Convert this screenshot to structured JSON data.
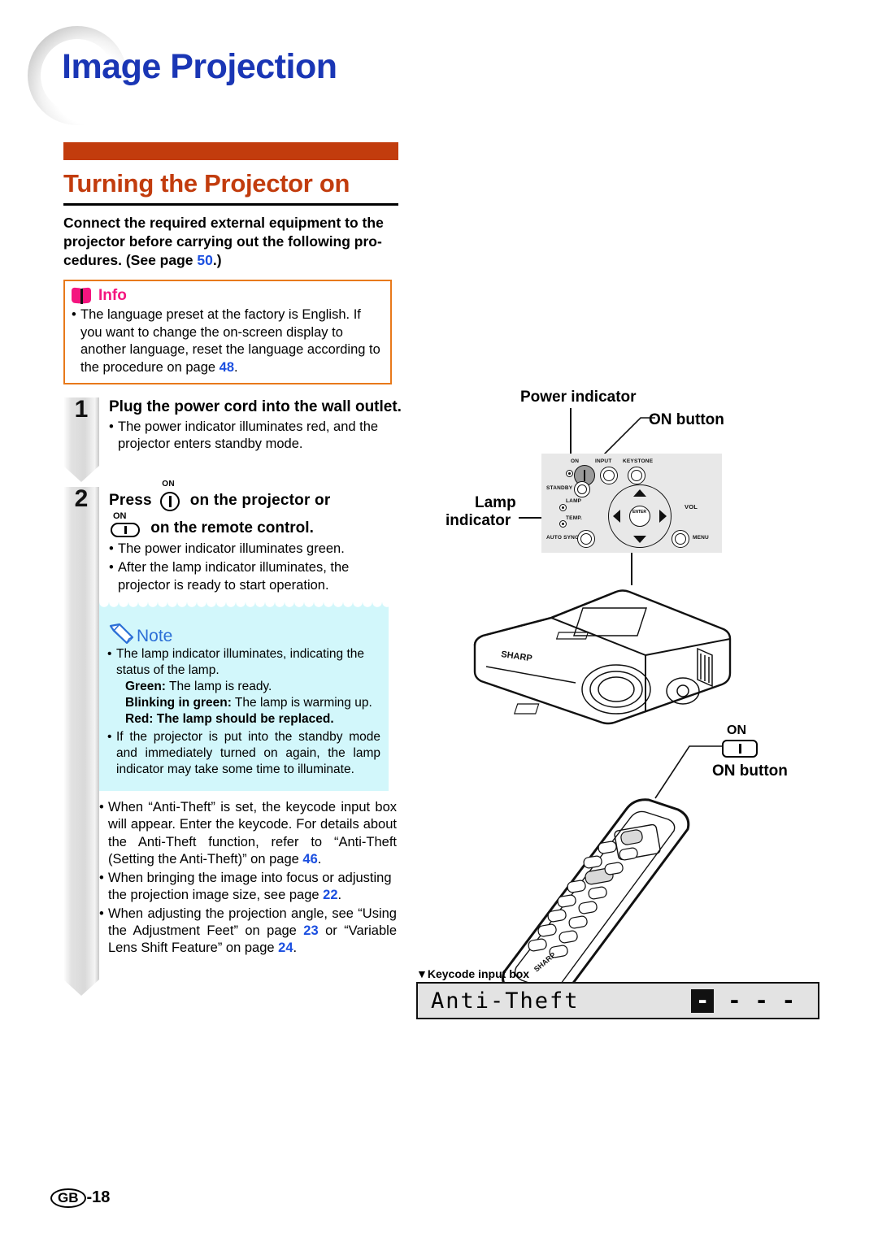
{
  "header": {
    "title": "Image Projection"
  },
  "section": {
    "title": "Turning the Projector on",
    "lead_part1": "Connect the required external equipment to the projector before carrying out the following pro-cedures. (See page ",
    "lead_page": "50",
    "lead_part2": ".)"
  },
  "info_box": {
    "icon": "book-icon",
    "label": "Info",
    "bullet_part1": "The language preset at the factory is English. If you want to change the on-screen display to another language, reset the language according to the procedure on page ",
    "bullet_page": "48",
    "bullet_part2": "."
  },
  "steps": [
    {
      "number": "1",
      "heading": "Plug the power cord into the wall outlet.",
      "bullets": [
        "The power indicator illuminates red, and the projector enters standby mode."
      ]
    },
    {
      "number": "2",
      "heading_pre": "Press",
      "heading_mid": "on the projector or",
      "heading_post": "on the remote control.",
      "on_icon_label": "ON",
      "bullets": [
        "The power indicator illuminates green.",
        "After the lamp indicator illuminates, the projector is ready to start operation."
      ]
    }
  ],
  "note_box": {
    "icon": "pencil-icon",
    "label": "Note",
    "bullet1": "The lamp indicator illuminates, indicating the status of the lamp.",
    "status_green_label": "Green:",
    "status_green_text": " The lamp is ready.",
    "status_blink_label": "Blinking in green:",
    "status_blink_text": " The lamp is warming up.",
    "status_red_label": "Red: The lamp should be replaced.",
    "bullet2": "If the projector is put into the standby mode and immediately turned on again, the lamp indicator may take some time to illuminate."
  },
  "tail_bullets": [
    {
      "part1": "When “Anti-Theft” is set, the keycode input box will appear. Enter the keycode. For details about the Anti-Theft function, refer to “Anti-Theft (Setting the Anti-Theft)” on page ",
      "page": "46",
      "part2": "."
    },
    {
      "part1": "When bringing the image into focus or adjusting the projection image size, see page ",
      "page": "22",
      "part2": "."
    },
    {
      "part1": "When adjusting the projection angle, see “Using the Adjustment Feet” on page ",
      "page": "23",
      "part2": " or “Variable Lens Shift Feature” on page ",
      "page2": "24",
      "part3": "."
    }
  ],
  "illustration": {
    "callouts": {
      "power_indicator": "Power indicator",
      "on_button_panel": "ON button",
      "lamp_indicator_line1": "Lamp",
      "lamp_indicator_line2": "indicator",
      "on_button_remote": "ON button",
      "remote_on_label": "ON"
    },
    "control_panel": {
      "on": "ON",
      "input": "INPUT",
      "keystone": "KEYSTONE",
      "standby": "STANDBY",
      "lamp": "LAMP",
      "temp": "TEMP.",
      "auto_sync": "AUTO SYNC",
      "menu": "MENU",
      "vol": "VOL",
      "enter": "ENTER"
    },
    "projector_brand": "SHARP",
    "remote_brand": "SHARP"
  },
  "keycode_box": {
    "caption": "▼Keycode input box",
    "title": "Anti-Theft",
    "slots": [
      "-",
      "-",
      "-",
      "-"
    ],
    "selected_index": 0
  },
  "footer": {
    "region": "GB",
    "page": "-18"
  }
}
